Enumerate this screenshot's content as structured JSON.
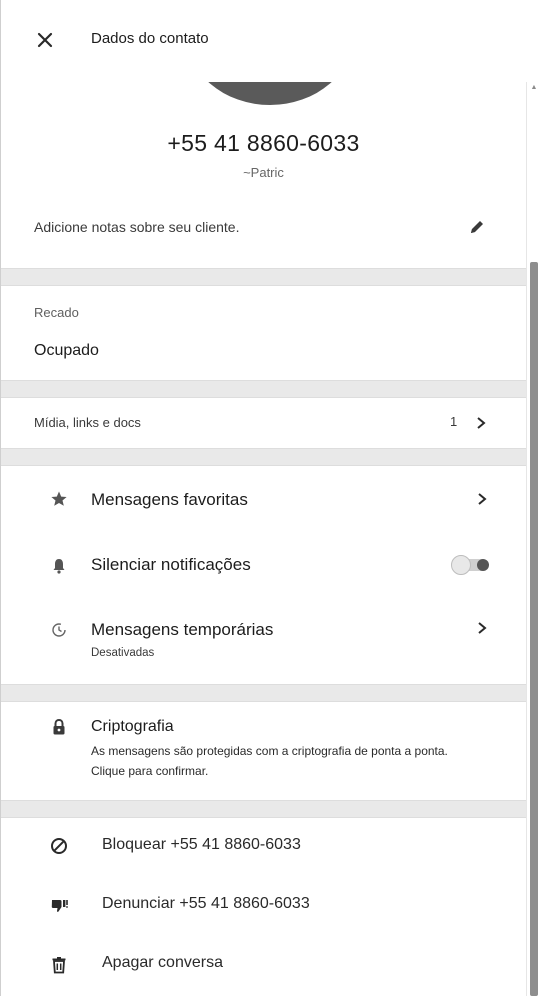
{
  "header": {
    "title": "Dados do contato"
  },
  "contact": {
    "phone": "+55 41 8860-6033",
    "name": "~Patric",
    "notes_placeholder": "Adicione notas sobre seu cliente."
  },
  "about": {
    "label": "Recado",
    "value": "Ocupado"
  },
  "media": {
    "label": "Mídia, links e docs",
    "count": "1"
  },
  "options": {
    "starred": "Mensagens favoritas",
    "mute": "Silenciar notificações",
    "mute_on": false,
    "disappearing": "Mensagens temporárias",
    "disappearing_status": "Desativadas"
  },
  "encryption": {
    "title": "Criptografia",
    "description": "As mensagens são protegidas com a criptografia de ponta a ponta. Clique para confirmar."
  },
  "actions": {
    "block": "Bloquear +55 41 8860-6033",
    "report": "Denunciar +55 41 8860-6033",
    "delete": "Apagar conversa"
  },
  "icons": {
    "close": "close-icon",
    "edit": "pencil-icon",
    "star": "star-icon",
    "bell": "bell-icon",
    "timer": "timer-icon",
    "lock": "lock-icon",
    "block": "block-icon",
    "thumbs_down": "thumbs-down-icon",
    "trash": "trash-icon"
  }
}
